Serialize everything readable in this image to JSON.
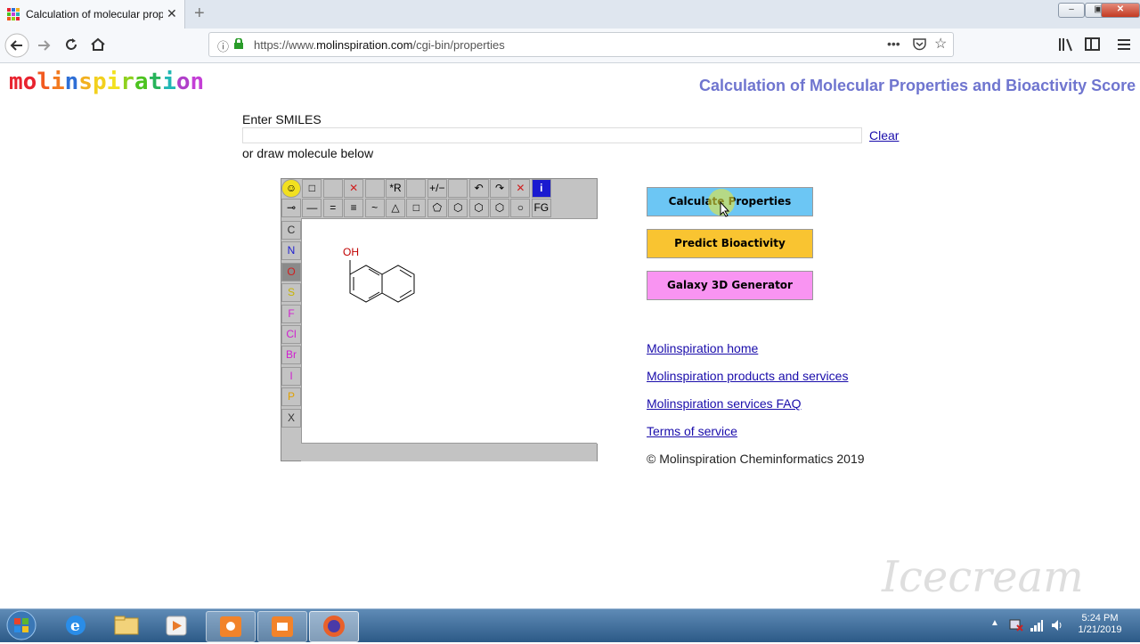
{
  "browser": {
    "tab_title": "Calculation of molecular prope",
    "tab_close": "✕",
    "new_tab": "+",
    "url_prefix": "https://www.",
    "url_domain": "molinspiration.com",
    "url_path": "/cgi-bin/properties",
    "window_controls": {
      "minimize": "‒",
      "maximize": "▣",
      "close": "✕"
    }
  },
  "page": {
    "logo_letters": [
      {
        "ch": "m",
        "color": "#e8232f"
      },
      {
        "ch": "o",
        "color": "#e8232f"
      },
      {
        "ch": "l",
        "color": "#f25a1f"
      },
      {
        "ch": "i",
        "color": "#f27a1f"
      },
      {
        "ch": "n",
        "color": "#2e6fd6"
      },
      {
        "ch": "s",
        "color": "#f2b01f"
      },
      {
        "ch": "p",
        "color": "#f2d01f"
      },
      {
        "ch": "i",
        "color": "#f2e11f"
      },
      {
        "ch": "r",
        "color": "#8fd11f"
      },
      {
        "ch": "a",
        "color": "#4cc31f"
      },
      {
        "ch": "t",
        "color": "#27b45a"
      },
      {
        "ch": "i",
        "color": "#21b7b4"
      },
      {
        "ch": "o",
        "color": "#b03fc9"
      },
      {
        "ch": "n",
        "color": "#c43fd6"
      }
    ],
    "title": "Calculation of Molecular Properties and Bioactivity Score",
    "smiles_label": "Enter SMILES",
    "smiles_value": "",
    "clear_label": "Clear",
    "draw_label": "or draw molecule below"
  },
  "editor": {
    "toolbar_row1": [
      "☺",
      "□",
      "",
      "✕",
      "",
      "*R",
      "",
      "+/−",
      "",
      "↶",
      "↷",
      "✕",
      "i"
    ],
    "toolbar_row2": [
      "⊸",
      "—",
      "=",
      "≡",
      "~",
      "△",
      "□",
      "⬠",
      "⬡",
      "⬡",
      "⬡",
      "○",
      "FG"
    ],
    "atoms": [
      {
        "label": "C",
        "color": "#333333"
      },
      {
        "label": "N",
        "color": "#2020d0"
      },
      {
        "label": "O",
        "color": "#d02020"
      },
      {
        "label": "S",
        "color": "#c8b400"
      },
      {
        "label": "F",
        "color": "#d020d0"
      },
      {
        "label": "Cl",
        "color": "#d020d0"
      },
      {
        "label": "Br",
        "color": "#d020d0"
      },
      {
        "label": "I",
        "color": "#d020d0"
      },
      {
        "label": "P",
        "color": "#e0a000"
      },
      {
        "label": "X",
        "color": "#333333"
      }
    ],
    "molecule_oh_label": "OH"
  },
  "actions": {
    "calculate": "Calculate Properties",
    "bioactivity": "Predict Bioactivity",
    "galaxy": "Galaxy 3D Generator"
  },
  "links": [
    "Molinspiration home",
    "Molinspiration products and services",
    "Molinspiration services FAQ",
    "Terms of service"
  ],
  "copyright": "© Molinspiration Cheminformatics 2019",
  "watermark": "Icecream",
  "taskbar": {
    "time": "5:24 PM",
    "date": "1/21/2019"
  }
}
